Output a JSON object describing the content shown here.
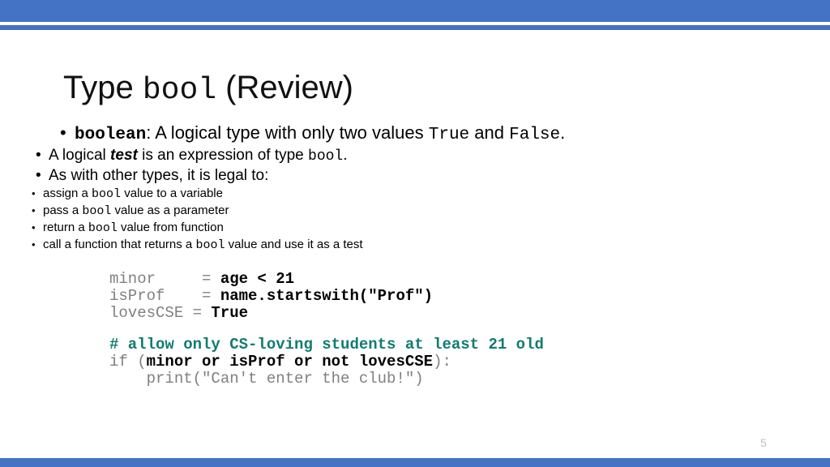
{
  "slide": {
    "page_number": "5",
    "accent_color": "#4472C4",
    "comment_color": "#117C6F",
    "code_dim_color": "#808080"
  },
  "title": {
    "part1": "Type ",
    "code": "bool",
    "part2": " (Review)"
  },
  "bullets": {
    "level1": {
      "marker": "•",
      "term": "boolean",
      "text_a": ": A logical type with only two values ",
      "code_true": "True",
      "text_b": " and ",
      "code_false": "False",
      "text_c": "."
    },
    "level2": [
      {
        "marker": "•",
        "text_a": "A logical ",
        "emph": "test",
        "text_b": " is an expression of type ",
        "code": "bool",
        "text_c": "."
      },
      {
        "marker": "•",
        "text_a": "As with other types, it is legal to:",
        "emph": "",
        "text_b": "",
        "code": "",
        "text_c": ""
      }
    ],
    "level3": [
      {
        "marker": "•",
        "text_a": "assign a ",
        "code": "bool",
        "text_b": " value to a variable"
      },
      {
        "marker": "•",
        "text_a": "pass a ",
        "code": "bool",
        "text_b": "  value as a parameter"
      },
      {
        "marker": "•",
        "text_a": "return a ",
        "code": "bool",
        "text_b": "  value from function"
      },
      {
        "marker": "•",
        "text_a": "call a function that returns a ",
        "code": "bool",
        "text_b": " value and use it as a test"
      }
    ]
  },
  "code": {
    "line1_dim": "minor     = ",
    "line1_strong": "age < 21",
    "line2_dim": "isProf    = ",
    "line2_strong": "name.startswith(\"Prof\")",
    "line3_dim": "lovesCSE = ",
    "line3_strong": "True",
    "comment": "# allow only CS-loving students at least 21 old",
    "line4_dim_a": "if (",
    "line4_strong": "minor or isProf or not lovesCSE",
    "line4_dim_b": "):",
    "line5_dim": "    print(\"Can't enter the club!\")"
  }
}
